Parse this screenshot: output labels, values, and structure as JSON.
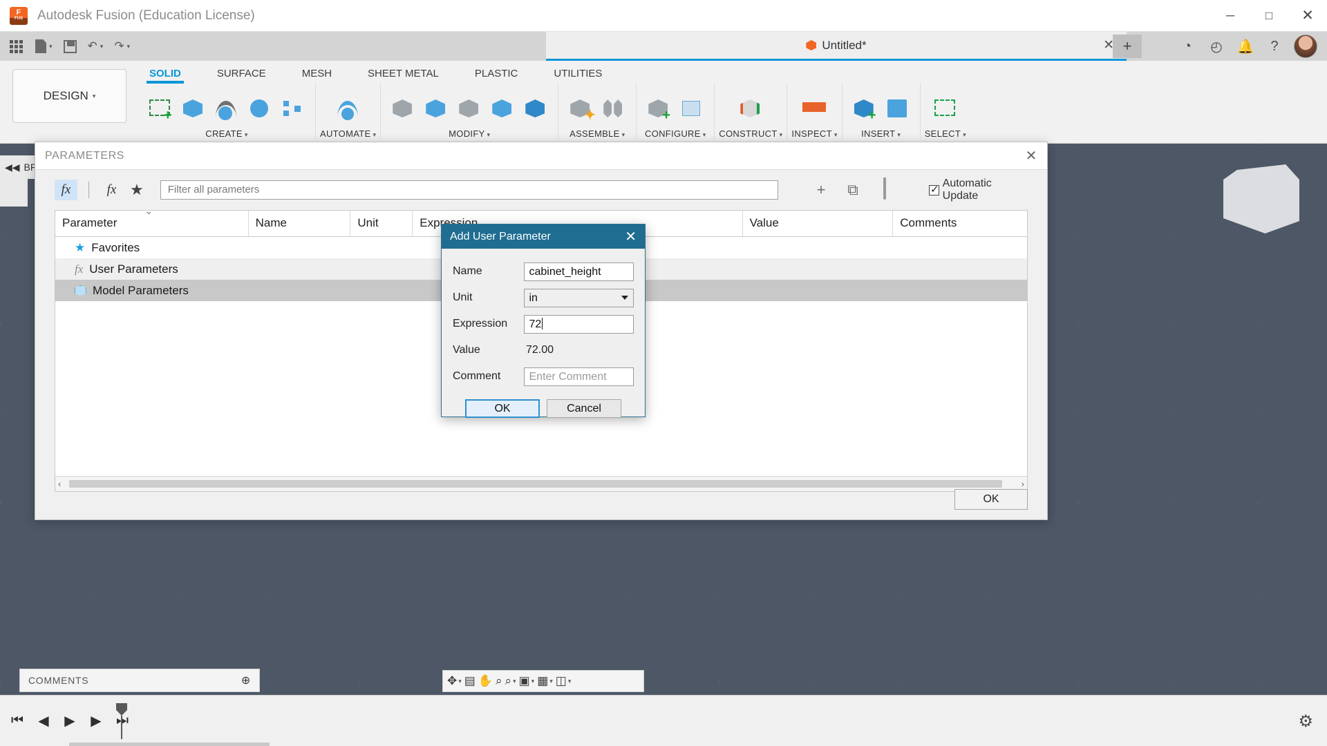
{
  "window": {
    "app_title": "Autodesk Fusion (Education License)",
    "logo_text": "F",
    "logo_sub": "FUS",
    "minimize": "─",
    "maximize": "□",
    "close": "✕"
  },
  "quick_access": {
    "items": [
      {
        "name": "app-grid",
        "icon": "grid-icon",
        "caret": false
      },
      {
        "name": "new-document",
        "icon": "document-icon",
        "caret": true
      },
      {
        "name": "save",
        "icon": "save-icon",
        "caret": false
      },
      {
        "name": "undo",
        "icon": "undo-icon",
        "glyph": "↶",
        "caret": true
      },
      {
        "name": "redo",
        "icon": "redo-icon",
        "glyph": "↷",
        "caret": true
      }
    ],
    "caret_glyph": "▾"
  },
  "document_tab": {
    "title": "Untitled*",
    "close": "✕",
    "new_tab": "+"
  },
  "header_buttons": [
    {
      "name": "extensions-icon",
      "glyph": "◔"
    },
    {
      "name": "job-status-icon",
      "glyph": "◴"
    },
    {
      "name": "notifications-bell-icon",
      "glyph": "🔔"
    },
    {
      "name": "help-icon",
      "glyph": "?"
    }
  ],
  "ribbon": {
    "workspace": "DESIGN",
    "workspace_caret": "▾",
    "tabs": [
      {
        "label": "SOLID",
        "active": true
      },
      {
        "label": "SURFACE",
        "active": false
      },
      {
        "label": "MESH",
        "active": false
      },
      {
        "label": "SHEET METAL",
        "active": false
      },
      {
        "label": "PLASTIC",
        "active": false
      },
      {
        "label": "UTILITIES",
        "active": false
      }
    ],
    "groups": [
      {
        "label": "CREATE",
        "caret": "▾",
        "icons": [
          "sketch-icon",
          "extrude-icon",
          "revolve-icon",
          "sweep-icon",
          "pattern-icon"
        ]
      },
      {
        "label": "AUTOMATE",
        "caret": "▾",
        "icons": [
          "automate-icon"
        ]
      },
      {
        "label": "MODIFY",
        "caret": "▾",
        "icons": [
          "press-pull-icon",
          "fillet-icon",
          "shell-icon",
          "combine-icon",
          "offset-face-icon"
        ]
      },
      {
        "label": "ASSEMBLE",
        "caret": "▾",
        "icons": [
          "new-component-icon",
          "joint-icon"
        ]
      },
      {
        "label": "CONFIGURE",
        "caret": "▾",
        "icons": [
          "configure-icon",
          "table-icon"
        ]
      },
      {
        "label": "CONSTRUCT",
        "caret": "▾",
        "icons": [
          "plane-icon"
        ]
      },
      {
        "label": "INSPECT",
        "caret": "▾",
        "icons": [
          "measure-icon"
        ]
      },
      {
        "label": "INSERT",
        "caret": "▾",
        "icons": [
          "insert-derive-icon",
          "canvas-icon"
        ]
      },
      {
        "label": "SELECT",
        "caret": "▾",
        "icons": [
          "select-icon"
        ]
      }
    ]
  },
  "browser": {
    "label": "BR"
  },
  "parameters_dialog": {
    "title": "PARAMETERS",
    "close": "✕",
    "toolbar": {
      "fx_button": "fx",
      "fx_user_button": "fx",
      "favorite_button": "★",
      "filter_placeholder": "Filter all parameters",
      "add_button": "+",
      "duplicate_button": "⧉",
      "delete_button": "delete-icon",
      "automatic_update_label": "Automatic Update",
      "automatic_update_checked": true
    },
    "columns": [
      "Parameter",
      "Name",
      "Unit",
      "Expression",
      "Value",
      "Comments"
    ],
    "sorted_column": "Parameter",
    "rows": [
      {
        "label": "Favorites",
        "icon": "star-icon",
        "selected": false,
        "alt": false
      },
      {
        "label": "User Parameters",
        "icon": "fx-icon",
        "selected": false,
        "alt": true
      },
      {
        "label": "Model Parameters",
        "icon": "cube-icon",
        "selected": true,
        "alt": false
      }
    ],
    "scroll_left": "‹",
    "scroll_right": "›",
    "ok_label": "OK"
  },
  "add_user_parameter": {
    "title": "Add User Parameter",
    "close": "✕",
    "fields": {
      "name_label": "Name",
      "name_value": "cabinet_height",
      "unit_label": "Unit",
      "unit_value": "in",
      "expression_label": "Expression",
      "expression_value": "72",
      "value_label": "Value",
      "value_text": "72.00",
      "comment_label": "Comment",
      "comment_placeholder": "Enter Comment"
    },
    "ok_label": "OK",
    "cancel_label": "Cancel"
  },
  "comments_panel": {
    "label": "COMMENTS",
    "add": "⊕"
  },
  "view_toolbar": [
    {
      "name": "orbit-icon",
      "glyph": "✥",
      "caret": true
    },
    {
      "name": "look-at-icon",
      "glyph": "▤",
      "caret": false
    },
    {
      "name": "pan-icon",
      "glyph": "✋",
      "caret": false
    },
    {
      "name": "zoom-icon",
      "glyph": "⌕",
      "caret": false
    },
    {
      "name": "zoom-window-icon",
      "glyph": "⌕",
      "caret": true
    },
    {
      "name": "display-settings-icon",
      "glyph": "▣",
      "caret": true
    },
    {
      "name": "grid-snaps-icon",
      "glyph": "▦",
      "caret": true
    },
    {
      "name": "viewports-icon",
      "glyph": "◫",
      "caret": true
    }
  ],
  "timeline": {
    "buttons": [
      {
        "name": "go-to-beginning-button",
        "glyph": "⏮"
      },
      {
        "name": "step-back-button",
        "glyph": "◀"
      },
      {
        "name": "play-button",
        "glyph": "▶"
      },
      {
        "name": "step-forward-button",
        "glyph": "▶"
      },
      {
        "name": "go-to-end-button",
        "glyph": "⏭"
      }
    ],
    "settings_icon": "⚙"
  },
  "colors": {
    "accent_blue": "#0696d7",
    "dialog_title_blue": "#1f6d91",
    "orange": "#f26522",
    "selection_gray": "#c8c8c8"
  }
}
